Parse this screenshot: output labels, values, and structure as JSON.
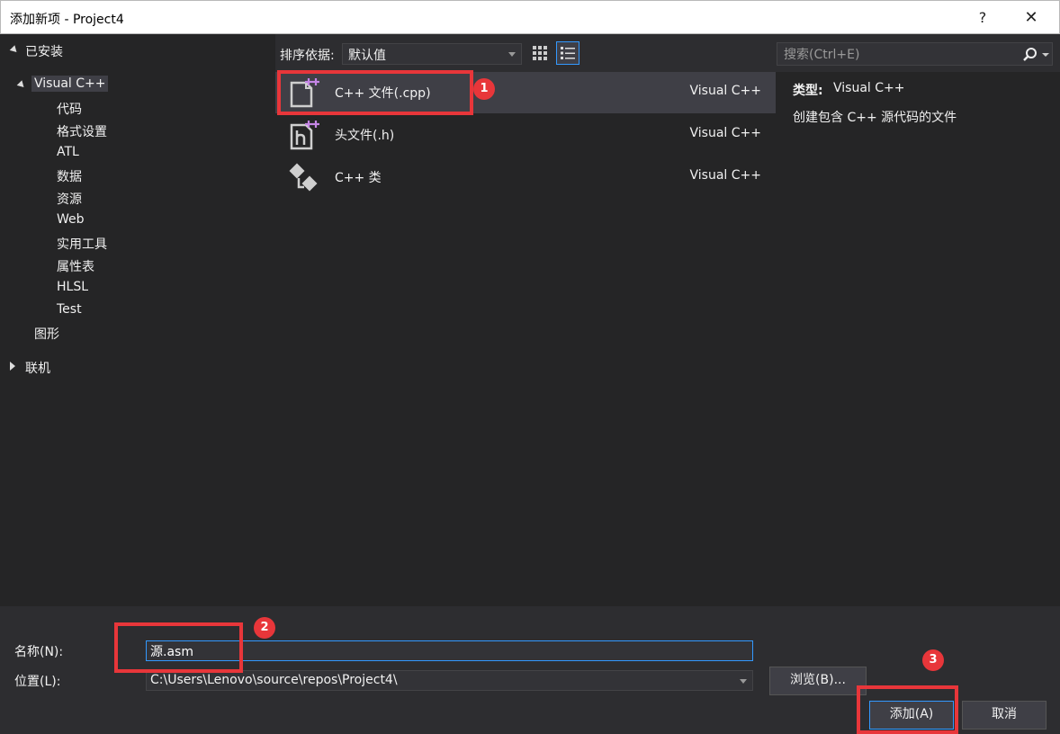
{
  "window": {
    "title": "添加新项 - Project4",
    "help": "?",
    "close": "✕"
  },
  "tree": {
    "installed": "已安装",
    "visual_cpp": "Visual C++",
    "children": [
      "代码",
      "格式设置",
      "ATL",
      "数据",
      "资源",
      "Web",
      "实用工具",
      "属性表",
      "HLSL",
      "Test"
    ],
    "graphics": "图形",
    "online": "联机"
  },
  "toolbar": {
    "sort_label": "排序依据:",
    "sort_value": "默认值",
    "search_placeholder": "搜索(Ctrl+E)"
  },
  "items": [
    {
      "label": "C++ 文件(.cpp)",
      "lang": "Visual C++",
      "icon": "cpp-file-icon",
      "selected": true
    },
    {
      "label": "头文件(.h)",
      "lang": "Visual C++",
      "icon": "header-file-icon",
      "selected": false
    },
    {
      "label": "C++ 类",
      "lang": "Visual C++",
      "icon": "cpp-class-icon",
      "selected": false
    }
  ],
  "details": {
    "type_label": "类型:",
    "type_value": "Visual C++",
    "description": "创建包含 C++ 源代码的文件"
  },
  "form": {
    "name_label": "名称(N):",
    "name_value": "源.asm",
    "location_label": "位置(L):",
    "location_value": "C:\\Users\\Lenovo\\source\\repos\\Project4\\",
    "browse": "浏览(B)...",
    "add": "添加(A)",
    "cancel": "取消"
  },
  "annotations": {
    "badge1": "1",
    "badge2": "2",
    "badge3": "3",
    "color": "#e8363a"
  }
}
